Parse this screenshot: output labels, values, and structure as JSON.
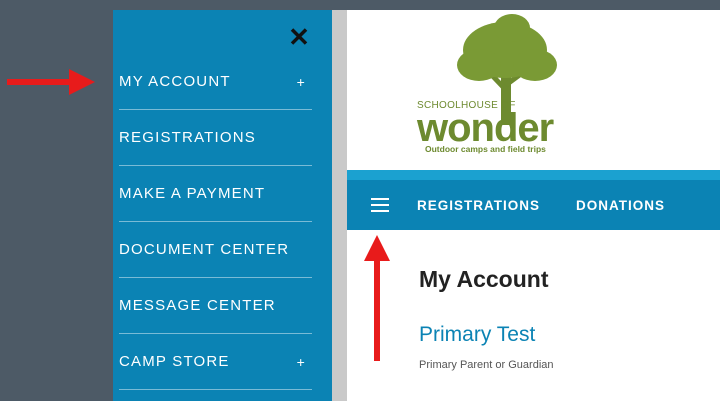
{
  "drawer": {
    "close_icon": "close-icon",
    "items": [
      {
        "label": "MY ACCOUNT",
        "expand": "+"
      },
      {
        "label": "REGISTRATIONS",
        "expand": ""
      },
      {
        "label": "MAKE A PAYMENT",
        "expand": ""
      },
      {
        "label": "DOCUMENT CENTER",
        "expand": ""
      },
      {
        "label": "MESSAGE CENTER",
        "expand": ""
      },
      {
        "label": "CAMP STORE",
        "expand": "+"
      }
    ]
  },
  "logo": {
    "top_text": "SCHOOLHOUSE OF",
    "main_text": "wonder",
    "tagline": "Outdoor camps and field trips"
  },
  "navbar": {
    "menu_icon": "hamburger-icon",
    "items": [
      "REGISTRATIONS",
      "DONATIONS"
    ]
  },
  "main": {
    "title": "My Account",
    "user_name": "Primary Test",
    "user_role": "Primary Parent or Guardian"
  },
  "colors": {
    "accent": "#0b83b4",
    "navbar_top": "#1ba1d0",
    "brand_green": "#6d8a2f",
    "annotation_red": "#e81b1b",
    "backdrop": "#4d5a66"
  }
}
